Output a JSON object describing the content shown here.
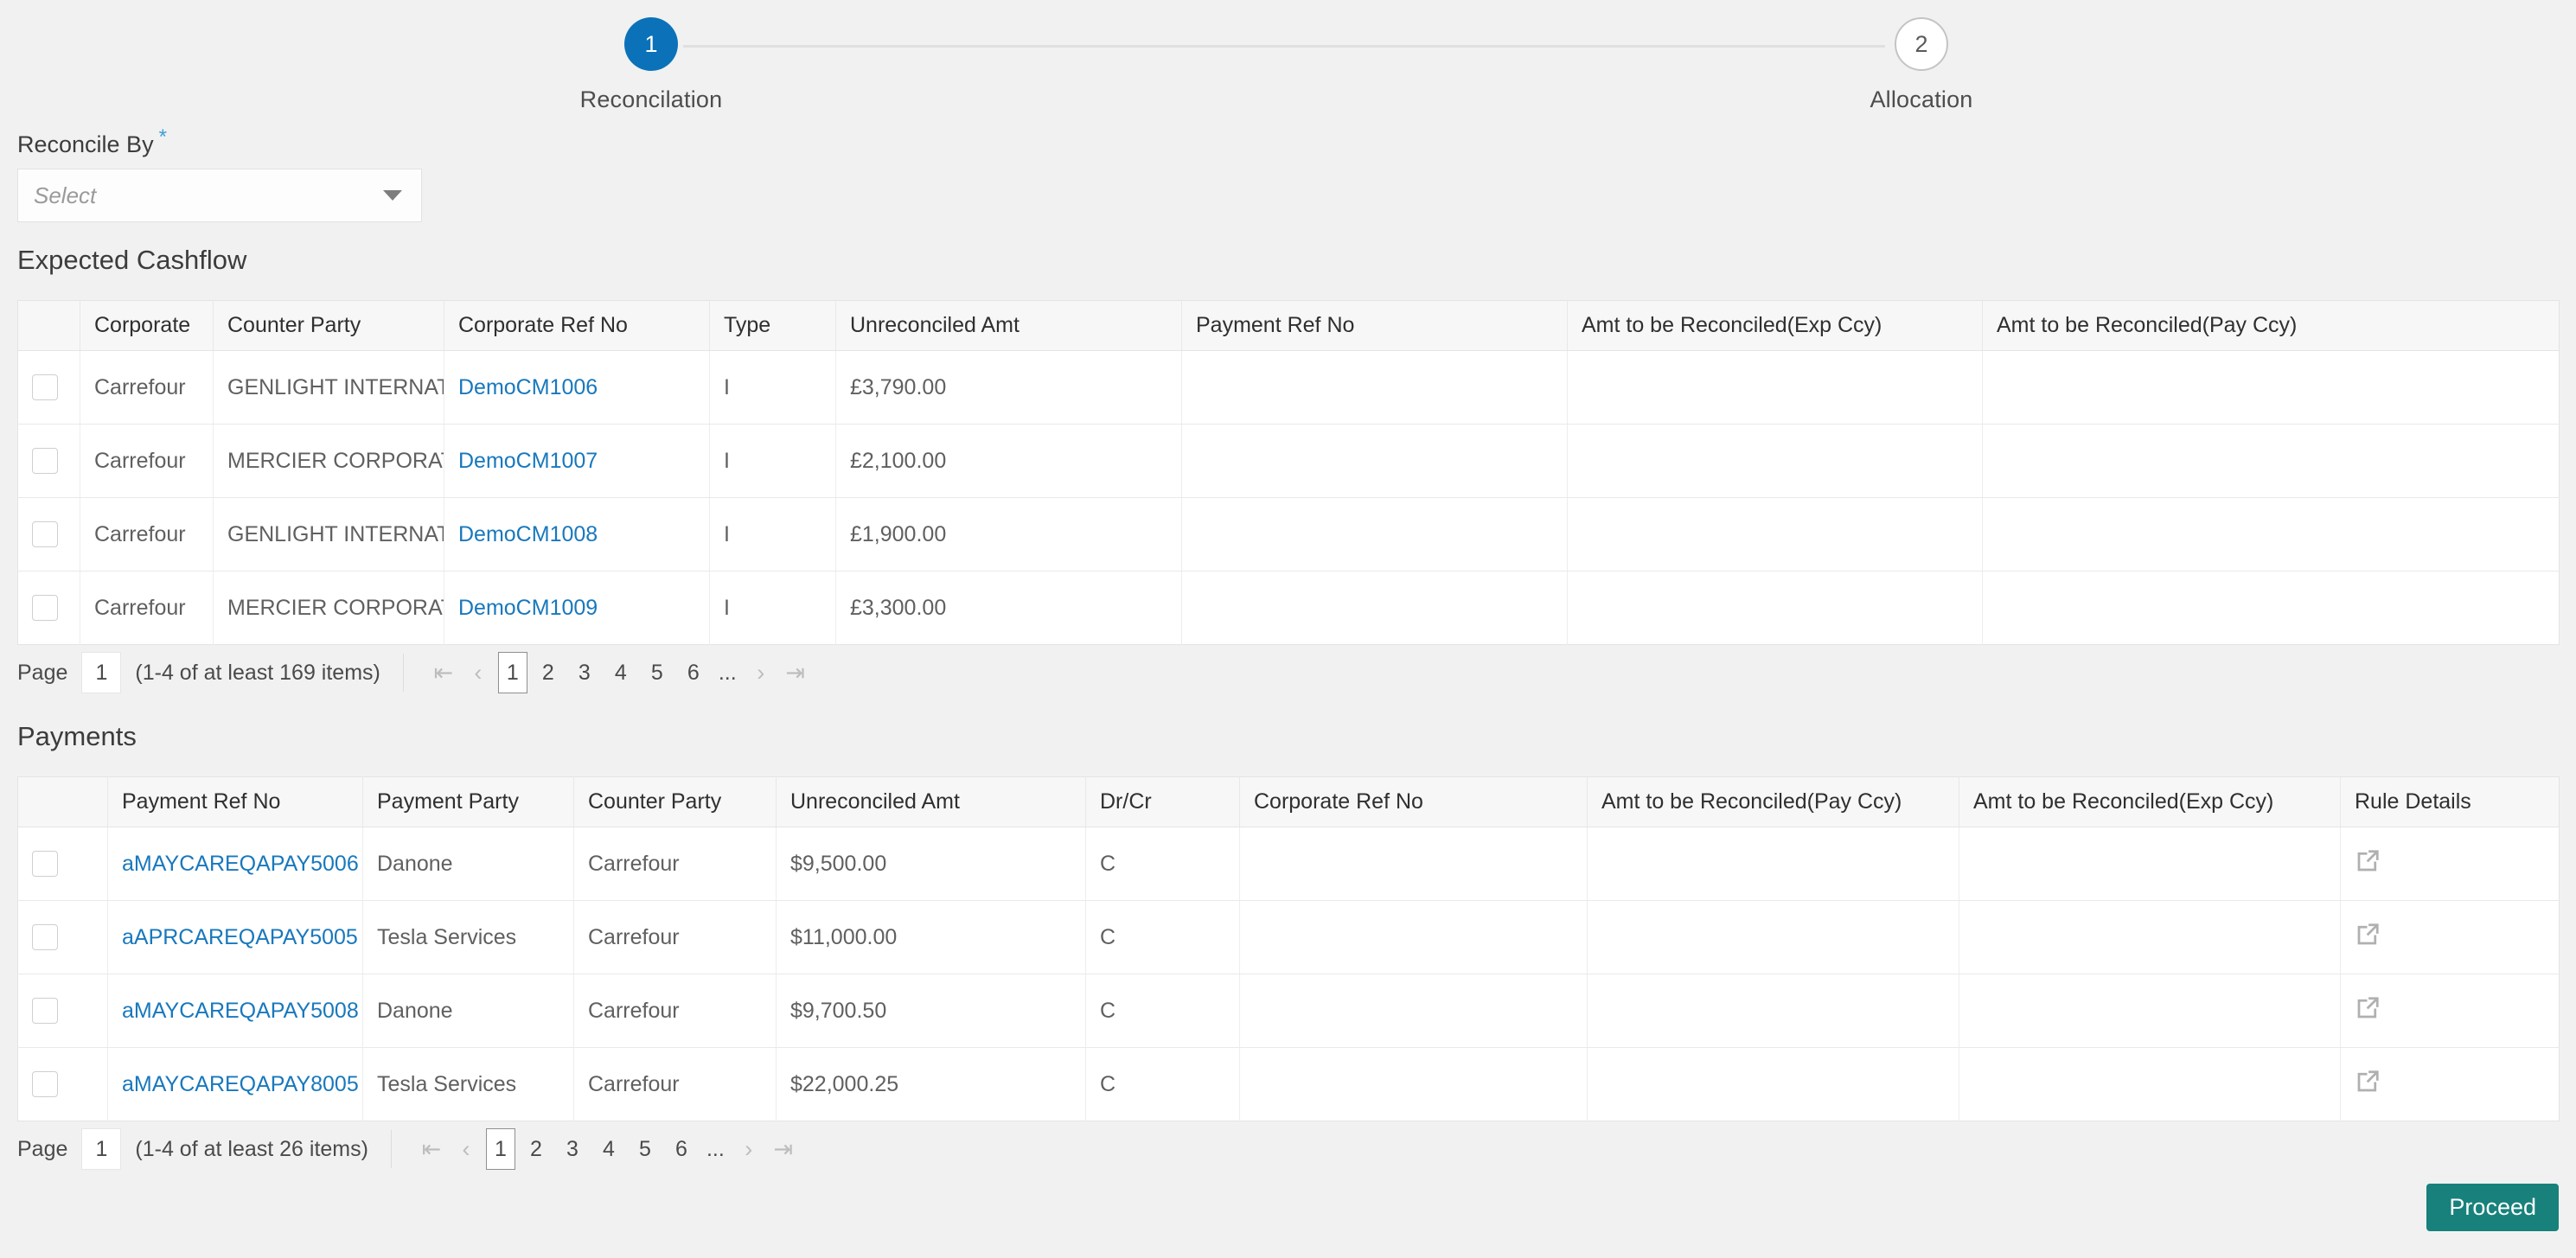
{
  "stepper": {
    "steps": [
      {
        "number": "1",
        "label": "Reconcilation",
        "state": "active"
      },
      {
        "number": "2",
        "label": "Allocation",
        "state": "inactive"
      }
    ],
    "active_color": "#0b72b9"
  },
  "form": {
    "reconcile_by": {
      "label": "Reconcile By",
      "required_marker": "*",
      "placeholder": "Select",
      "value": ""
    }
  },
  "expected_cashflow": {
    "title": "Expected Cashflow",
    "columns": [
      "",
      "Corporate",
      "Counter Party",
      "Corporate Ref No",
      "Type",
      "Unreconciled Amt",
      "Payment Ref No",
      "Amt to be Reconciled(Exp Ccy)",
      "Amt to be Reconciled(Pay Ccy)"
    ],
    "rows": [
      {
        "corporate": "Carrefour",
        "counter_party": "GENLIGHT INTERNATIONAL",
        "corporate_ref_no": "DemoCM1006",
        "type": "I",
        "unreconciled_amt": "£3,790.00",
        "payment_ref_no": "",
        "amt_exp_ccy": "",
        "amt_pay_ccy": ""
      },
      {
        "corporate": "Carrefour",
        "counter_party": "MERCIER CORPORATION",
        "corporate_ref_no": "DemoCM1007",
        "type": "I",
        "unreconciled_amt": "£2,100.00",
        "payment_ref_no": "",
        "amt_exp_ccy": "",
        "amt_pay_ccy": ""
      },
      {
        "corporate": "Carrefour",
        "counter_party": "GENLIGHT INTERNATIONAL",
        "corporate_ref_no": "DemoCM1008",
        "type": "I",
        "unreconciled_amt": "£1,900.00",
        "payment_ref_no": "",
        "amt_exp_ccy": "",
        "amt_pay_ccy": ""
      },
      {
        "corporate": "Carrefour",
        "counter_party": "MERCIER CORPORATION",
        "corporate_ref_no": "DemoCM1009",
        "type": "I",
        "unreconciled_amt": "£3,300.00",
        "payment_ref_no": "",
        "amt_exp_ccy": "",
        "amt_pay_ccy": ""
      }
    ],
    "pagination": {
      "page_label": "Page",
      "page_value": "1",
      "count_text": "(1-4 of at least 169 items)",
      "first_icon": "first-page-icon",
      "prev_icon": "previous-page-icon",
      "pages": [
        "1",
        "2",
        "3",
        "4",
        "5",
        "6"
      ],
      "ellipsis": "...",
      "current_page": "1",
      "next_icon": "next-page-icon",
      "last_icon": "last-page-icon"
    }
  },
  "payments": {
    "title": "Payments",
    "columns": [
      "",
      "Payment Ref No",
      "Payment Party",
      "Counter Party",
      "Unreconciled Amt",
      "Dr/Cr",
      "Corporate Ref No",
      "Amt to be Reconciled(Pay Ccy)",
      "Amt to be Reconciled(Exp Ccy)",
      "Rule Details"
    ],
    "rows": [
      {
        "payment_ref_no": "aMAYCAREQAPAY5006",
        "payment_party": "Danone",
        "counter_party": "Carrefour",
        "unreconciled_amt": "$9,500.00",
        "dr_cr": "C",
        "corporate_ref_no": "",
        "amt_pay_ccy": "",
        "amt_exp_ccy": "",
        "rule_details_icon": "external-link-icon"
      },
      {
        "payment_ref_no": "aAPRCAREQAPAY5005",
        "payment_party": "Tesla Services",
        "counter_party": "Carrefour",
        "unreconciled_amt": "$11,000.00",
        "dr_cr": "C",
        "corporate_ref_no": "",
        "amt_pay_ccy": "",
        "amt_exp_ccy": "",
        "rule_details_icon": "external-link-icon"
      },
      {
        "payment_ref_no": "aMAYCAREQAPAY5008",
        "payment_party": "Danone",
        "counter_party": "Carrefour",
        "unreconciled_amt": "$9,700.50",
        "dr_cr": "C",
        "corporate_ref_no": "",
        "amt_pay_ccy": "",
        "amt_exp_ccy": "",
        "rule_details_icon": "external-link-icon"
      },
      {
        "payment_ref_no": "aMAYCAREQAPAY8005",
        "payment_party": "Tesla Services",
        "counter_party": "Carrefour",
        "unreconciled_amt": "$22,000.25",
        "dr_cr": "C",
        "corporate_ref_no": "",
        "amt_pay_ccy": "",
        "amt_exp_ccy": "",
        "rule_details_icon": "external-link-icon"
      }
    ],
    "pagination": {
      "page_label": "Page",
      "page_value": "1",
      "count_text": "(1-4 of at least 26 items)",
      "first_icon": "first-page-icon",
      "prev_icon": "previous-page-icon",
      "pages": [
        "1",
        "2",
        "3",
        "4",
        "5",
        "6"
      ],
      "ellipsis": "...",
      "current_page": "1",
      "next_icon": "next-page-icon",
      "last_icon": "last-page-icon"
    }
  },
  "footer": {
    "proceed_label": "Proceed",
    "proceed_color": "#18817b"
  }
}
